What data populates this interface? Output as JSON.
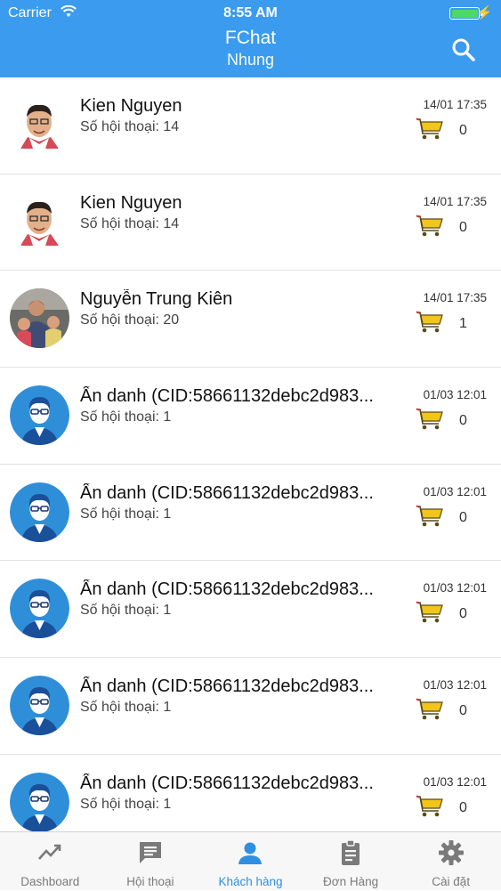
{
  "status_bar": {
    "carrier": "Carrier",
    "time": "8:55 AM"
  },
  "header": {
    "title": "FChat",
    "subtitle": "Nhung"
  },
  "customers": [
    {
      "name": "Kien Nguyen",
      "conversations": "Số hội thoại: 14",
      "date": "14/01 17:35",
      "orders": "0",
      "avatar": "photo-man-icon"
    },
    {
      "name": "Kien Nguyen",
      "conversations": "Số hội thoại: 14",
      "date": "14/01 17:35",
      "orders": "0",
      "avatar": "photo-man-icon"
    },
    {
      "name": "Nguyễn Trung Kiên",
      "conversations": "Số hội thoại: 20",
      "date": "14/01 17:35",
      "orders": "1",
      "avatar": "photo-family-icon"
    },
    {
      "name": "Ẩn danh (CID:58661132debc2d983...",
      "conversations": "Số hội thoại: 1",
      "date": "01/03 12:01",
      "orders": "0",
      "avatar": "anonymous-user-icon"
    },
    {
      "name": "Ẩn danh (CID:58661132debc2d983...",
      "conversations": "Số hội thoại: 1",
      "date": "01/03 12:01",
      "orders": "0",
      "avatar": "anonymous-user-icon"
    },
    {
      "name": "Ẩn danh (CID:58661132debc2d983...",
      "conversations": "Số hội thoại: 1",
      "date": "01/03 12:01",
      "orders": "0",
      "avatar": "anonymous-user-icon"
    },
    {
      "name": "Ẩn danh (CID:58661132debc2d983...",
      "conversations": "Số hội thoại: 1",
      "date": "01/03 12:01",
      "orders": "0",
      "avatar": "anonymous-user-icon"
    },
    {
      "name": "Ẩn danh (CID:58661132debc2d983...",
      "conversations": "Số hội thoại: 1",
      "date": "01/03 12:01",
      "orders": "0",
      "avatar": "anonymous-user-icon"
    }
  ],
  "tabs": [
    {
      "label": "Dashboard",
      "icon": "trending-up-icon",
      "active": false
    },
    {
      "label": "Hội thoại",
      "icon": "chat-icon",
      "active": false
    },
    {
      "label": "Khách  hàng",
      "icon": "person-icon",
      "active": true
    },
    {
      "label": "Đơn Hàng",
      "icon": "clipboard-icon",
      "active": false
    },
    {
      "label": "Cài đặt",
      "icon": "gear-icon",
      "active": false
    }
  ],
  "colors": {
    "header": "#3a9bef",
    "active_tab": "#2f8fe2",
    "cart": "#f2c51b",
    "cart_outline": "#5a4a1a",
    "avatar_bg": "#2e8fd8",
    "battery": "#4cd964"
  }
}
